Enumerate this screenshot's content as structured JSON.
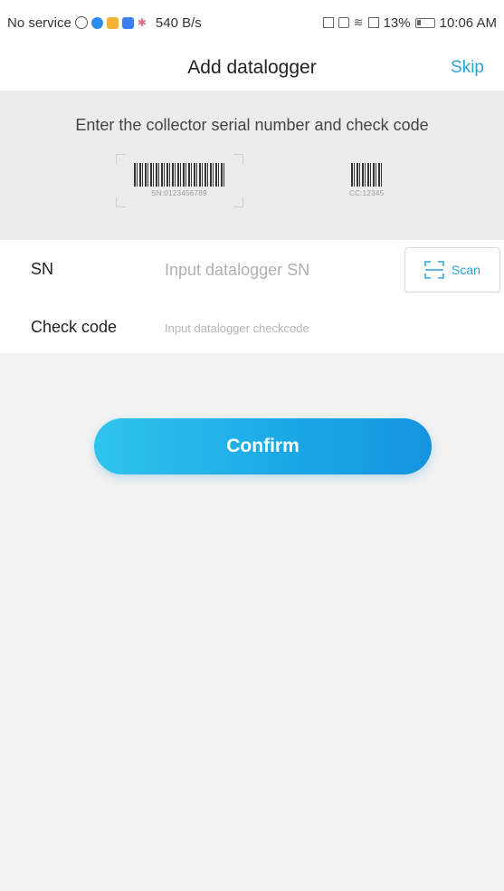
{
  "status_bar": {
    "left_text": "No service",
    "network_speed": "540 B/s",
    "battery_percent": "13%",
    "time": "10:06 AM",
    "icons": [
      "globe-icon",
      "app-icon-blue",
      "app-icon-orange",
      "app-icon-square",
      "signal-icon",
      "nfc-icon",
      "vibrate-icon",
      "wifi-icon",
      "sim-icon",
      "battery-icon"
    ]
  },
  "header": {
    "title": "Add datalogger",
    "skip_label": "Skip"
  },
  "instruction": {
    "text": "Enter the collector serial number and check code",
    "sn_example": "SN:0123456789",
    "cc_example": "CC:12345"
  },
  "form": {
    "sn_label": "SN",
    "sn_placeholder": "Input datalogger SN",
    "sn_value": "",
    "scan_label": "Scan",
    "check_label": "Check code",
    "check_placeholder": "Input datalogger checkcode",
    "check_value": ""
  },
  "confirm_label": "Confirm",
  "colors": {
    "accent": "#2aa5d9",
    "button_gradient_start": "#2fc4ec",
    "button_gradient_end": "#1593e0",
    "background": "#f2f2f2"
  }
}
